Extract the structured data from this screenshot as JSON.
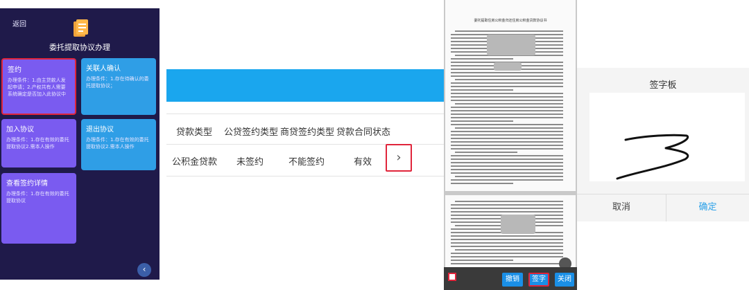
{
  "panel1": {
    "back_label": "返回",
    "title": "委托提取协议办理",
    "cards": [
      {
        "title": "签约",
        "desc": "办理条件：1.由主贷款人发起申请；2.产权共有人需要系统确定是否加入此协议中"
      },
      {
        "title": "关联人确认",
        "desc": "办理条件：1.存在待确认的委托提取协议；"
      },
      {
        "title": "加入协议",
        "desc": "办理条件：1.存在有效的委托提取协议2.需本人操作"
      },
      {
        "title": "退出协议",
        "desc": "办理条件：1.存在有效的委托提取协议2.需本人操作"
      },
      {
        "title": "查看签约详情",
        "desc": "办理条件：1.存在有效的委托提取协议"
      }
    ],
    "back_arrow": "‹",
    "colors": {
      "background": "#1f1a4a",
      "purple": "#7a5bf0",
      "blue": "#2f9ee6",
      "highlight": "#e0243a"
    }
  },
  "panel2": {
    "headers": [
      "贷款类型",
      "公贷签约类型",
      "商贷签约类型",
      "贷款合同状态"
    ],
    "row": [
      "公积金贷款",
      "未签约",
      "不能签约",
      "有效"
    ],
    "arrow": "›",
    "colors": {
      "bar": "#1aa6ee"
    }
  },
  "panel3": {
    "doc_title": "委托提取住房公积金归还住房公积金贷款协议书",
    "buttons": {
      "undo": "撤销",
      "sign": "签字",
      "close": "关闭"
    }
  },
  "panel4": {
    "title": "签字板",
    "cancel": "取消",
    "confirm": "确定",
    "colors": {
      "confirm": "#2aa0e8"
    }
  }
}
